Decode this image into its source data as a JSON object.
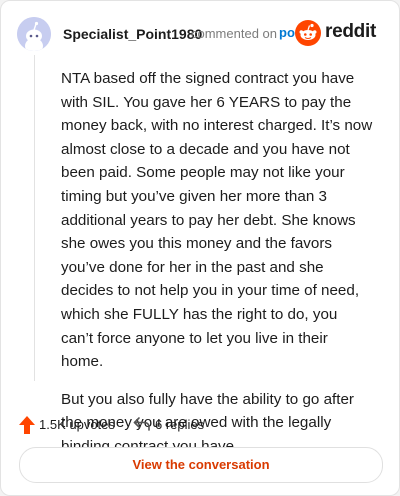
{
  "comment": {
    "username": "Specialist_Point1980",
    "action_text": "commented on",
    "post_link": "post",
    "brand": "reddit",
    "paragraphs": [
      "NTA based off the signed contract you have with SIL. You gave her 6 YEARS to pay the money back, with no interest charged. It’s now almost close to a decade and you have not been paid. Some people may not like your timing but you’ve given her more than 3 additional years to pay her debt. She knows she owes you this money and the favors you’ve done for her in the past and she decides to not help you in your time of need, which she FULLY has the right to do, you can’t force anyone to let you live in their home.",
      "But you also fully have the ability to go after the money you are owed with the legally binding contract you have."
    ],
    "upvotes": "1.5K upvotes",
    "replies": "6 replies",
    "cta": "View the conversation"
  },
  "icons": {
    "avatar": "snoo-avatar-icon",
    "brand": "reddit-logo-icon",
    "upvote": "upvote-arrow-icon",
    "reply": "reply-arrow-icon"
  },
  "colors": {
    "brand_orange": "#ff4500",
    "link_blue": "#0079d3",
    "cta_text": "#d93a00",
    "avatar_bg": "#c7cdf0"
  }
}
